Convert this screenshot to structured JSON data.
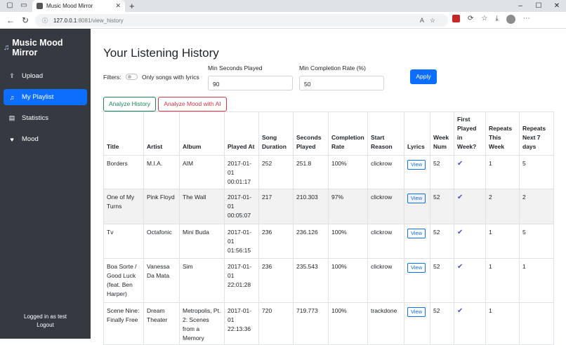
{
  "browser": {
    "tab_title": "Music Mood Mirror",
    "url_host": "127.0.0.1",
    "url_path": ":8081/view_history"
  },
  "sidebar": {
    "brand": "Music Mood Mirror",
    "items": [
      {
        "label": "Upload",
        "icon": "upload-icon"
      },
      {
        "label": "My Playlist",
        "icon": "music-note-icon"
      },
      {
        "label": "Statistics",
        "icon": "chart-icon"
      },
      {
        "label": "Mood",
        "icon": "heart-icon"
      }
    ],
    "logged_in": "Logged in as test",
    "logout": "Logout"
  },
  "page": {
    "title": "Your Listening History",
    "filters_label": "Filters:",
    "lyrics_toggle_label": "Only songs with lyrics",
    "min_seconds_label": "Min Seconds Played",
    "min_seconds_value": "90",
    "min_completion_label": "Min Completion Rate (%)",
    "min_completion_value": "50",
    "apply": "Apply",
    "analyze_history": "Analyze History",
    "analyze_mood": "Analyze Mood with AI"
  },
  "table": {
    "headers": [
      "Title",
      "Artist",
      "Album",
      "Played At",
      "Song Duration",
      "Seconds Played",
      "Completion Rate",
      "Start Reason",
      "Lyrics",
      "Week Num",
      "First Played in Week?",
      "Repeats This Week",
      "Repeats Next 7 days"
    ],
    "view_label": "View",
    "rows": [
      {
        "title": "Borders",
        "artist": "M.I.A.",
        "album": "AIM",
        "played_at": "2017-01-01 00:01:17",
        "duration": "252",
        "seconds": "251.8",
        "completion": "100%",
        "reason": "clickrow",
        "week": "52",
        "rep_week": "1",
        "rep_next": "5"
      },
      {
        "title": "One of My Turns",
        "artist": "Pink Floyd",
        "album": "The Wall",
        "played_at": "2017-01-01 00:05:07",
        "duration": "217",
        "seconds": "210.303",
        "completion": "97%",
        "reason": "clickrow",
        "week": "52",
        "rep_week": "2",
        "rep_next": "2"
      },
      {
        "title": "Tv",
        "artist": "Octafonic",
        "album": "Mini Buda",
        "played_at": "2017-01-01 01:56:15",
        "duration": "236",
        "seconds": "236.126",
        "completion": "100%",
        "reason": "clickrow",
        "week": "52",
        "rep_week": "1",
        "rep_next": "5"
      },
      {
        "title": "Boa Sorte / Good Luck (feat. Ben Harper)",
        "artist": "Vanessa Da Mata",
        "album": "Sim",
        "played_at": "2017-01-01 22:01:28",
        "duration": "236",
        "seconds": "235.543",
        "completion": "100%",
        "reason": "clickrow",
        "week": "52",
        "rep_week": "1",
        "rep_next": "1"
      },
      {
        "title": "Scene Nine: Finally Free",
        "artist": "Dream Theater",
        "album": "Metropolis, Pt. 2: Scenes from a Memory",
        "played_at": "2017-01-01 22:13:36",
        "duration": "720",
        "seconds": "719.773",
        "completion": "100%",
        "reason": "trackdone",
        "week": "52",
        "rep_week": "1",
        "rep_next": ""
      }
    ]
  }
}
